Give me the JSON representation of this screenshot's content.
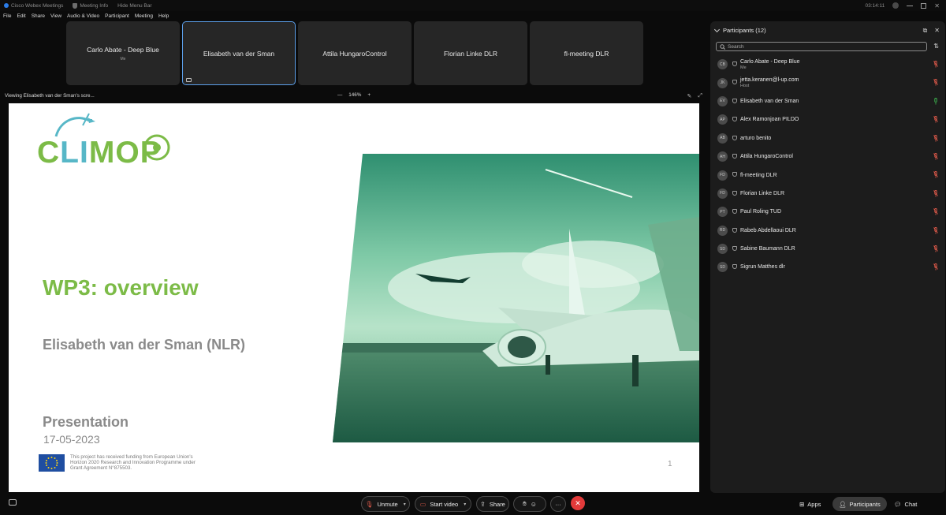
{
  "titlebar": {
    "app_title": "Cisco Webex Meetings",
    "meeting_info": "Meeting Info",
    "hide_menu": "Hide Menu Bar",
    "time": "03:14:11"
  },
  "menu": [
    "File",
    "Edit",
    "Share",
    "View",
    "Audio & Video",
    "Participant",
    "Meeting",
    "Help"
  ],
  "tiles": [
    {
      "name": "Carlo Abate - Deep Blue",
      "sub": "Me"
    },
    {
      "name": "Elisabeth van der Sman",
      "sub": ""
    },
    {
      "name": "Attila HungaroControl",
      "sub": ""
    },
    {
      "name": "Florian Linke DLR",
      "sub": ""
    },
    {
      "name": "fl-meeting DLR",
      "sub": ""
    }
  ],
  "viewing": {
    "text": "Viewing Elisabeth van der Sman's scre...",
    "zoom": "146%"
  },
  "slide": {
    "logo_text": "CLIMOP",
    "title": "WP3: overview",
    "author": "Elisabeth van der Sman (NLR)",
    "presentation": "Presentation",
    "date": "17-05-2023",
    "eu_text": "This project has received funding from European Union's Horizon 2020 Research and Innovation Programme under Grant Agreement N°875503.",
    "page_number": "1"
  },
  "participants_panel": {
    "title": "Participants (12)",
    "search_placeholder": "Search",
    "people": [
      {
        "initials": "CB",
        "name": "Carlo Abate - Deep Blue",
        "role": "Me",
        "mic": "muted"
      },
      {
        "initials": "JK",
        "name": "jetta.keranen@l-up.com",
        "role": "Host",
        "mic": "muted"
      },
      {
        "initials": "EV",
        "name": "Elisabeth van der Sman",
        "role": "",
        "mic": "active"
      },
      {
        "initials": "AP",
        "name": "Alex Ramonjoan PILDO",
        "role": "",
        "mic": "muted"
      },
      {
        "initials": "AB",
        "name": "arturo benito",
        "role": "",
        "mic": "muted"
      },
      {
        "initials": "AH",
        "name": "Attila HungaroControl",
        "role": "",
        "mic": "muted"
      },
      {
        "initials": "FD",
        "name": "fl-meeting DLR",
        "role": "",
        "mic": "muted"
      },
      {
        "initials": "FD",
        "name": "Florian Linke DLR",
        "role": "",
        "mic": "muted"
      },
      {
        "initials": "PT",
        "name": "Paul Roling TUD",
        "role": "",
        "mic": "muted"
      },
      {
        "initials": "RD",
        "name": "Rabeb Abdellaoui DLR",
        "role": "",
        "mic": "muted"
      },
      {
        "initials": "SD",
        "name": "Sabine Baumann DLR",
        "role": "",
        "mic": "muted"
      },
      {
        "initials": "SD",
        "name": "Sigrun Matthes dlr",
        "role": "",
        "mic": "muted"
      }
    ]
  },
  "controls": {
    "unmute": "Unmute",
    "start_video": "Start video",
    "share": "Share",
    "apps": "Apps",
    "participants": "Participants",
    "chat": "Chat",
    "more": "···"
  },
  "colors": {
    "accent_green": "#7cbb47",
    "end_red": "#e23a3a",
    "active_border": "#5b9ee8",
    "muted_red": "#e05a4a",
    "active_green": "#3fb950"
  }
}
